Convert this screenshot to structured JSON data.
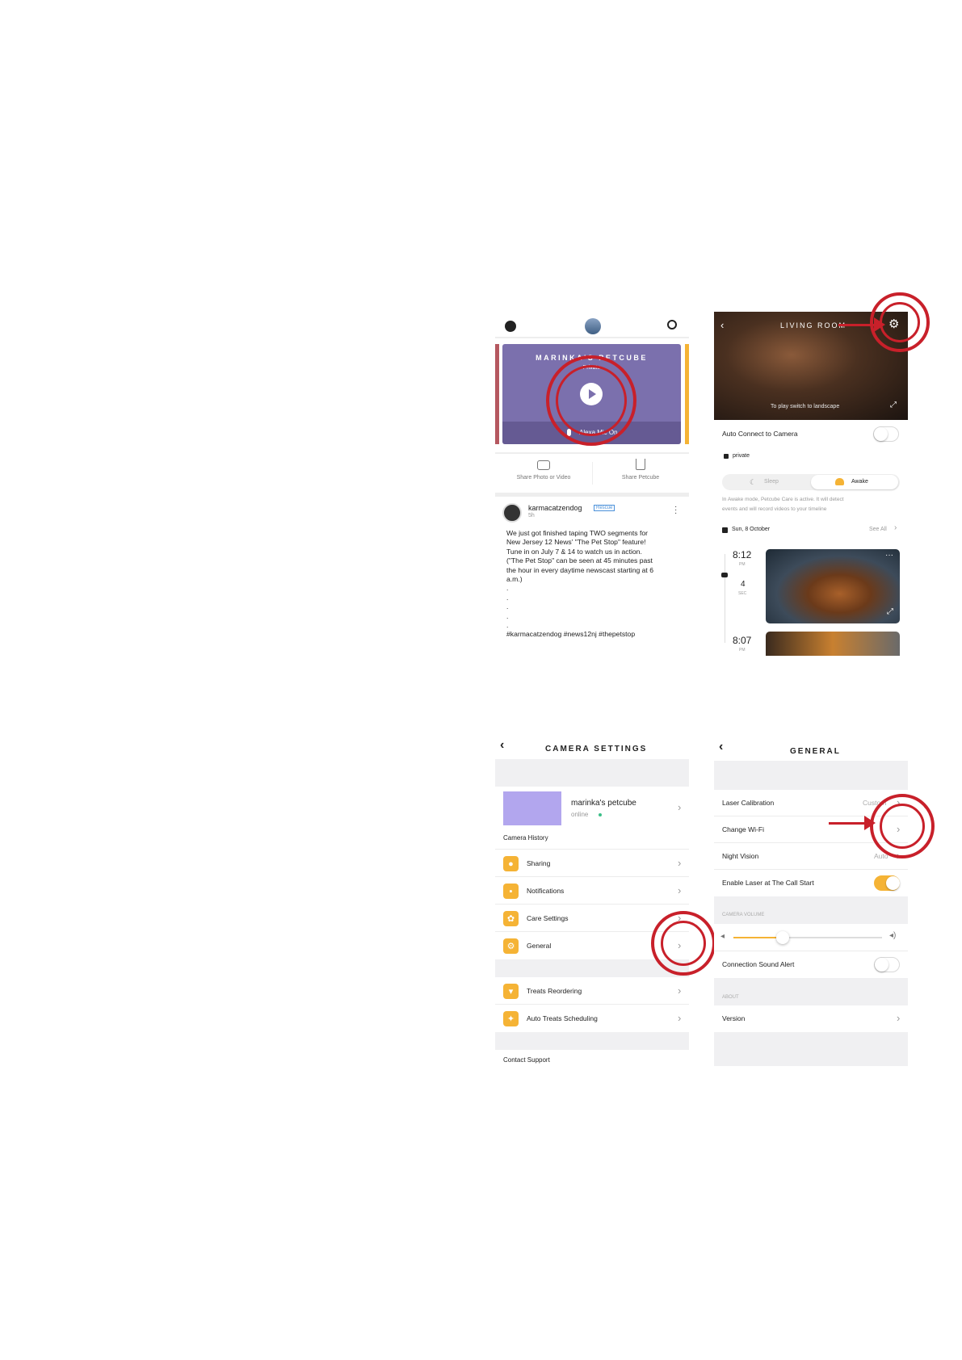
{
  "feed": {
    "banner_title": "MARINKA'S PETCUBE",
    "privacy": "Private",
    "mic_label": "Alexa Mic On",
    "share_photo": "Share Photo or Video",
    "share_petcube": "Share Petcube",
    "post": {
      "author": "karmacatzendog",
      "badge": "Rescue",
      "time": "5h",
      "text_lines": [
        "We just got finished taping TWO segments for",
        "New Jersey 12 News' \"The Pet Stop\" feature!",
        "Tune in on July 7 & 14 to watch us in action.",
        "(\"The Pet Stop\" can be seen at 45 minutes past",
        "the hour in every daytime newscast starting at 6",
        "a.m.)"
      ],
      "dots": [
        ".",
        ".",
        ".",
        ".",
        "."
      ],
      "hashtags": "#karmacatzendog #news12nj #thepetstop"
    }
  },
  "living": {
    "title": "LIVING ROOM",
    "landscape_hint": "To play switch to landscape",
    "auto_connect": "Auto Connect to Camera",
    "private": "private",
    "sleep": "Sleep",
    "awake": "Awake",
    "mode_desc_1": "In Awake mode, Petcube Care is active. It will detect",
    "mode_desc_2": "events and will record videos to your timeline",
    "date": "Sun, 8 October",
    "see_all": "See All",
    "events": [
      {
        "time": "8:12",
        "ampm": "PM",
        "dur": "4",
        "unit": "SEC"
      },
      {
        "time": "8:07",
        "ampm": "PM"
      }
    ]
  },
  "camera_settings": {
    "title": "CAMERA SETTINGS",
    "cam_name": "marinka's petcube",
    "cam_status": "online",
    "camera_history": "Camera History",
    "items": [
      "Sharing",
      "Notifications",
      "Care Settings",
      "General"
    ],
    "items2": [
      "Treats Reordering",
      "Auto Treats Scheduling"
    ],
    "contact": "Contact Support"
  },
  "general": {
    "title": "GENERAL",
    "laser_calibration": "Laser Calibration",
    "laser_value": "Custom",
    "change_wifi": "Change Wi-Fi",
    "night_vision": "Night Vision",
    "night_value": "Auto",
    "enable_laser": "Enable Laser at The Call Start",
    "camera_volume": "CAMERA VOLUME",
    "volume_level": 0.33,
    "connection_alert": "Connection Sound Alert",
    "about": "ABOUT",
    "version": "Version"
  },
  "colors": {
    "accent": "#f5b335",
    "annotation": "#c8202a",
    "banner": "#7b70ad"
  }
}
